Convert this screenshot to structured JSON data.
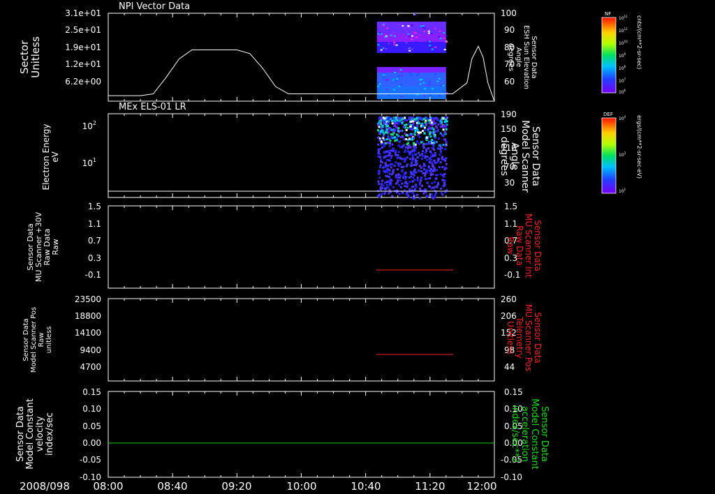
{
  "footer": {
    "date_label": "2008/098",
    "x_tick_labels": [
      "08:00",
      "08:40",
      "09:20",
      "10:00",
      "10:40",
      "11:20",
      "12:00"
    ]
  },
  "colors": {
    "background": "#000000",
    "axis": "#ffffff",
    "red_trace": "#ff2020",
    "green_trace": "#10d010",
    "right_label_red": "#ff1a1a",
    "right_label_green": "#10e010"
  },
  "panels": [
    {
      "title": "NPI Vector Data",
      "left_label": [
        "Sector",
        "Unitless"
      ],
      "left_ticks": [
        "3.1e+01",
        "2.5e+01",
        "1.9e+01",
        "1.2e+01",
        "6.2e+00"
      ],
      "right_ticks": [
        "100",
        "90",
        "80",
        "70",
        "60"
      ],
      "right_label": [
        "Sensor Data",
        "ESH Sun Elevation",
        "Angle",
        "degrees"
      ]
    },
    {
      "title": "MEx ELS-01 LR",
      "left_label": [
        "Electron Energy",
        "eV"
      ],
      "left_ticks": [
        "10",
        "10"
      ],
      "left_tick_exponents": [
        "2",
        "1"
      ],
      "right_ticks": [
        "190",
        "150",
        "110",
        "70",
        "30"
      ],
      "right_label": [
        "Sensor Data",
        "Model Scanner",
        "Angle",
        "degrees"
      ]
    },
    {
      "title": "",
      "left_label": [
        "Sensor Data",
        "MU Scanner +30V",
        "Raw Data",
        "Raw"
      ],
      "left_ticks": [
        "1.5",
        "1.1",
        "0.7",
        "0.3",
        "-0.1"
      ],
      "right_ticks": [
        "1.5",
        "1.1",
        "0.7",
        "0.3",
        "-0.1"
      ],
      "right_label": [
        "Sensor Data",
        "MU Scanner Int",
        "Raw Data",
        "Raw"
      ]
    },
    {
      "title": "",
      "left_label": [
        "Sensor Data",
        "Model Scanner Pos",
        "Raw",
        "unitless"
      ],
      "left_ticks": [
        "23500",
        "18800",
        "14100",
        "9400",
        "4700"
      ],
      "right_ticks": [
        "260",
        "206",
        "152",
        "98",
        "44"
      ],
      "right_label": [
        "Sensor Data",
        "MU Scanner Pos",
        "Telemetry",
        "Unitless"
      ]
    },
    {
      "title": "",
      "left_label": [
        "Sensor Data",
        "Model Constant",
        "velocity",
        "index/sec"
      ],
      "left_ticks": [
        "0.15",
        "0.10",
        "0.05",
        "0.00",
        "-0.05",
        "-0.10"
      ],
      "right_ticks": [
        "0.15",
        "0.10",
        "0.05",
        "0.00",
        "-0.05",
        "-0.10"
      ],
      "right_label": [
        "Sensor Data",
        "Model Constant",
        "acceleration",
        "index/sec**2"
      ]
    }
  ],
  "colorbars": [
    {
      "name": "NF",
      "tick_labels": [
        "10",
        "10",
        "10",
        "10",
        "10",
        "10",
        "10"
      ],
      "tick_exponents": [
        "12",
        "11",
        "10",
        "9",
        "8",
        "7",
        "6"
      ],
      "units": "cnts/(cm**2-sr-sec)"
    },
    {
      "name": "DEF",
      "tick_labels": [
        "10",
        "10",
        "10"
      ],
      "tick_exponents": [
        "4",
        "3",
        "2"
      ],
      "units": "ergs/(cm**2-sr-sec-eV)"
    }
  ],
  "chart_data": [
    {
      "type": "line",
      "title": "NPI Vector Data",
      "x_range": [
        "2008/098 08:00",
        "2008/098 12:00"
      ],
      "ylabel": "Sector Unitless",
      "y2label": "Sensor Data ESH Sun Elevation Angle degrees",
      "y2lim": [
        52,
        100
      ],
      "series": [
        {
          "x": [
            "08:00",
            "08:20",
            "08:28",
            "08:36",
            "08:44",
            "08:52",
            "09:20",
            "09:28",
            "09:36",
            "09:44",
            "09:52",
            "11:34",
            "11:43",
            "11:46",
            "11:50",
            "11:53",
            "11:56",
            "12:00"
          ],
          "y2": [
            55,
            55,
            56,
            65,
            75,
            80,
            80,
            78,
            70,
            60,
            56,
            56,
            62,
            75,
            82,
            76,
            62,
            52
          ]
        }
      ],
      "spectrogram": {
        "colorbar": "NF",
        "x_range": [
          "10:47",
          "11:30"
        ],
        "bands": "sectors near 2.5e+01 to 3.1e+01 and 6.2e+00 to 1.2e+01"
      }
    },
    {
      "type": "heatmap",
      "title": "MEx ELS-01 LR",
      "ylabel": "Electron Energy eV",
      "y_scale": "log",
      "y2label": "Sensor Data Model Scanner Angle degrees",
      "y2lim": [
        10,
        190
      ],
      "colorbar": "DEF",
      "data_x_range": [
        "10:47",
        "11:30"
      ],
      "overlay_line": {
        "y2": 10
      }
    },
    {
      "type": "line",
      "ylabel": "Sensor Data MU Scanner +30V Raw Data Raw",
      "ylim": [
        -0.3,
        1.5
      ],
      "y2label": "Sensor Data MU Scanner Int Raw Data Raw",
      "y2lim": [
        -0.3,
        1.5
      ],
      "series": [
        {
          "color": "#ff2020",
          "x": [
            "10:45",
            "11:32"
          ],
          "y": [
            0.05,
            0.05
          ]
        }
      ]
    },
    {
      "type": "line",
      "ylabel": "Sensor Data Model Scanner Pos Raw unitless",
      "ylim": [
        0,
        23500
      ],
      "y2label": "Sensor Data MU Scanner Pos Telemetry Unitless",
      "y2lim": [
        0,
        260
      ],
      "series": [
        {
          "color": "#ff2020",
          "x": [
            "10:45",
            "11:32"
          ],
          "y": [
            8800,
            8800
          ]
        }
      ]
    },
    {
      "type": "line",
      "ylabel": "Sensor Data Model Constant velocity index/sec",
      "ylim": [
        -0.1,
        0.15
      ],
      "y2label": "Sensor Data Model Constant acceleration index/sec**2",
      "y2lim": [
        -0.1,
        0.15
      ],
      "series": [
        {
          "color": "#10d010",
          "x": [
            "08:00",
            "12:00"
          ],
          "y": [
            0.0,
            0.0
          ]
        }
      ]
    }
  ]
}
